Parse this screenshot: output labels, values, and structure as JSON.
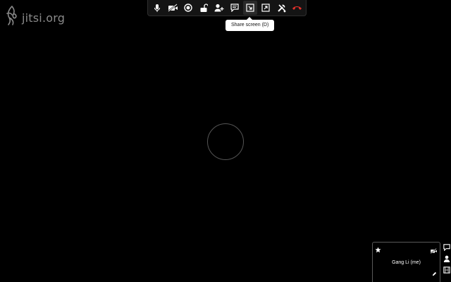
{
  "logo": {
    "text": "jitsi.org",
    "icon": "jitsi-logo-icon"
  },
  "toolbar": {
    "buttons": [
      {
        "name": "microphone-button",
        "icon": "microphone-icon"
      },
      {
        "name": "camera-button",
        "icon": "camera-off-icon"
      },
      {
        "name": "recording-button",
        "icon": "recording-icon"
      },
      {
        "name": "lock-button",
        "icon": "unlock-icon"
      },
      {
        "name": "invite-button",
        "icon": "add-user-icon"
      },
      {
        "name": "chat-button",
        "icon": "chat-icon"
      },
      {
        "name": "share-screen-button",
        "icon": "share-screen-icon"
      },
      {
        "name": "fullscreen-button",
        "icon": "fullscreen-icon"
      },
      {
        "name": "settings-button",
        "icon": "tools-icon"
      },
      {
        "name": "hangup-button",
        "icon": "hangup-icon"
      }
    ],
    "tooltip": "Share screen (D)",
    "hangup_color": "#e0302a"
  },
  "local_video": {
    "name": "Gang Li (me)",
    "icons": [
      "star-icon",
      "camera-off-icon",
      "pencil-icon"
    ]
  },
  "side_panel": {
    "icons": [
      "chat-icon",
      "contacts-icon",
      "film-icon"
    ]
  }
}
